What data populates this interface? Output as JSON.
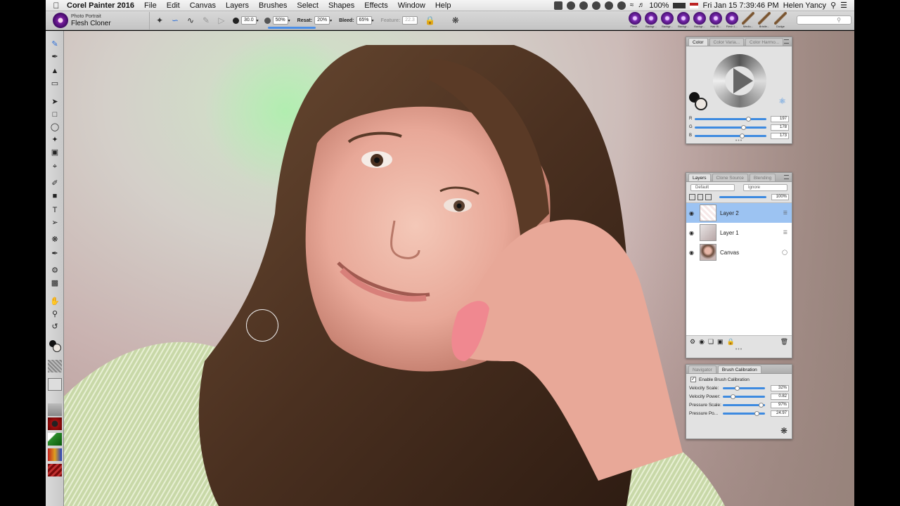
{
  "menubar": {
    "app_name": "Corel Painter 2016",
    "menus": [
      "File",
      "Edit",
      "Canvas",
      "Layers",
      "Brushes",
      "Select",
      "Shapes",
      "Effects",
      "Window",
      "Help"
    ],
    "battery": "100%",
    "datetime": "Fri Jan 15  7:39:46 PM",
    "user": "Helen Yancy"
  },
  "propbar": {
    "brush_category": "Photo Portrait",
    "brush_variant": "Flesh Cloner",
    "size_value": "30.0",
    "opacity_value": "50%",
    "resat_label": "Resat:",
    "resat_value": "20%",
    "bleed_label": "Bleed:",
    "bleed_value": "65%",
    "feature_label": "Feature:",
    "feature_value": "22.3"
  },
  "dock": {
    "items": [
      "Flesh...",
      "Backgr...",
      "Backgr...",
      "Backgr...",
      "Backgr...",
      "Hair Bl...",
      "Flesh L...",
      "Mediu...",
      "Bristle...",
      "Dodge"
    ]
  },
  "color_panel": {
    "tabs": [
      "Color",
      "Color Varia...",
      "Color Harmo..."
    ],
    "r_label": "R",
    "g_label": "G",
    "b_label": "B",
    "r": 197,
    "g": 178,
    "b": 173,
    "r_text": "197",
    "g_text": "178",
    "b_text": "173"
  },
  "layers_panel": {
    "tabs": [
      "Layers",
      "Clone Source",
      "Blending"
    ],
    "composite_method": "Default",
    "preserve_transparency": "Ignore",
    "opacity": "100%",
    "layers": [
      {
        "name": "Layer 2",
        "selected": true
      },
      {
        "name": "Layer 1",
        "selected": false
      },
      {
        "name": "Canvas",
        "selected": false
      }
    ]
  },
  "calibration_panel": {
    "tabs": [
      "Navigator",
      "Brush Calibration"
    ],
    "enable_label": "Enable Brush Calibration",
    "rows": [
      {
        "label": "Velocity Scale:",
        "value": "32%",
        "level": 0.32
      },
      {
        "label": "Velocity Power:",
        "value": "0.82",
        "level": 0.2
      },
      {
        "label": "Pressure Scale:",
        "value": "97%",
        "level": 0.97
      },
      {
        "label": "Pressure Po...",
        "value": "24.97",
        "level": 0.85
      }
    ]
  },
  "colors": {
    "accent_blue": "#3d8ae0",
    "selected_layer": "#9cc3f2",
    "brush_purple": "#7a1fa0"
  }
}
